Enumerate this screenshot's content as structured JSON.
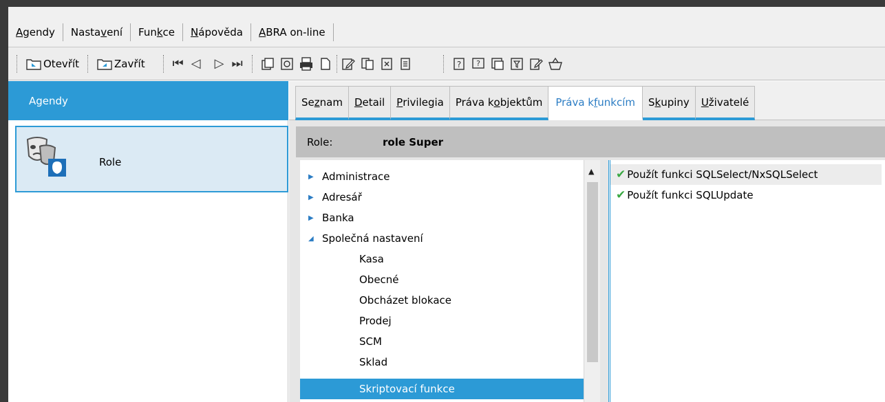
{
  "menu": [
    {
      "pre": "",
      "u": "A",
      "post": "gendy"
    },
    {
      "pre": "Nasta",
      "u": "v",
      "post": "ení"
    },
    {
      "pre": "Fun",
      "u": "k",
      "post": "ce"
    },
    {
      "pre": "",
      "u": "N",
      "post": "ápověda"
    },
    {
      "pre": "",
      "u": "A",
      "post": "BRA on-line"
    }
  ],
  "toolbar": {
    "open_label": "Otevřít",
    "close_label": "Zavřít",
    "nav_icons": [
      "first-record-icon",
      "prev-record-icon",
      "next-record-icon",
      "last-record-icon"
    ]
  },
  "left": {
    "header": "Agendy",
    "items": [
      {
        "label": "Role",
        "icon": "role-masks-icon"
      }
    ]
  },
  "tabs": [
    {
      "pre": "Se",
      "u": "z",
      "post": "nam",
      "active": false
    },
    {
      "pre": "",
      "u": "D",
      "post": "etail",
      "active": false
    },
    {
      "pre": "",
      "u": "P",
      "post": "rivilegia",
      "active": false
    },
    {
      "pre": "Práva k ",
      "u": "o",
      "post": "bjektům",
      "active": false
    },
    {
      "pre": "Práva k ",
      "u": "f",
      "post": "unkcím",
      "active": true
    },
    {
      "pre": "S",
      "u": "k",
      "post": "upiny",
      "active": false
    },
    {
      "pre": "",
      "u": "U",
      "post": "živatelé",
      "active": false
    }
  ],
  "role": {
    "key": "Role:",
    "value": "role Super"
  },
  "tree": [
    {
      "label": "Administrace",
      "state": "collapsed",
      "level": 0
    },
    {
      "label": "Adresář",
      "state": "collapsed",
      "level": 0
    },
    {
      "label": "Banka",
      "state": "collapsed",
      "level": 0
    },
    {
      "label": "Společná nastavení",
      "state": "expanded",
      "level": 0
    },
    {
      "label": "Kasa",
      "state": "leaf",
      "level": 1
    },
    {
      "label": "Obecné",
      "state": "leaf",
      "level": 1
    },
    {
      "label": "Obcházet blokace",
      "state": "leaf",
      "level": 1
    },
    {
      "label": "Prodej",
      "state": "leaf",
      "level": 1
    },
    {
      "label": "SCM",
      "state": "leaf",
      "level": 1
    },
    {
      "label": "Sklad",
      "state": "leaf",
      "level": 1
    },
    {
      "label": "Skriptovací funkce",
      "state": "leaf",
      "level": 1,
      "selected": true
    }
  ],
  "functions": [
    {
      "label": "Použít funkci SQLSelect/NxSQLSelect",
      "checked": true,
      "highlighted": true
    },
    {
      "label": "Použít funkci SQLUpdate",
      "checked": true,
      "highlighted": false
    }
  ],
  "colors": {
    "accent": "#2c9ad6",
    "check": "#3aa843",
    "frame": "#3a3a3a"
  }
}
